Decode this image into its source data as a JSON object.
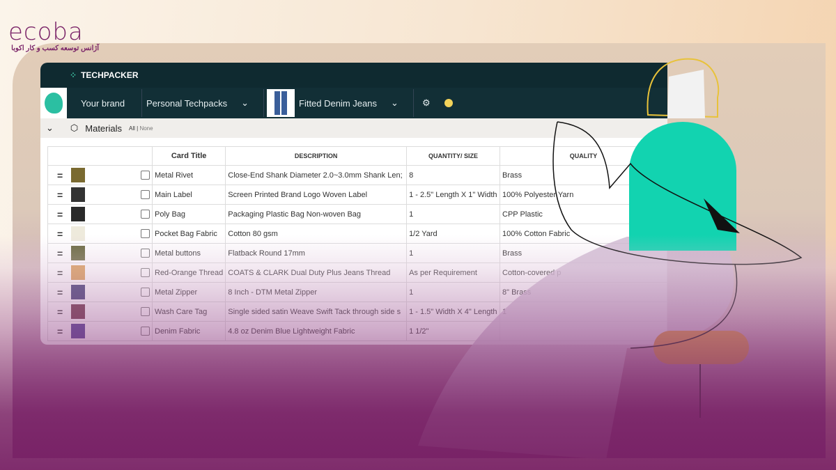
{
  "watermark": {
    "brand": "ecoba",
    "tagline": "آژانس توسعه کسب و کار اکوبا"
  },
  "app": {
    "name": "TECHPACKER"
  },
  "nav": {
    "brand": "Your brand",
    "workspace": "Personal Techpacks",
    "product": "Fitted Denim Jeans"
  },
  "section": {
    "title": "Materials",
    "all": "All",
    "sep": "|",
    "none": "None"
  },
  "table": {
    "headers": [
      "Card Title",
      "DESCRIPTION",
      "QUANTITY/ SIZE",
      "QUALITY"
    ],
    "rows": [
      {
        "title": "Metal Rivet",
        "description": "Close-End  Shank Diameter 2.0~3.0mm Shank Len;",
        "qty": "8",
        "quality": "Brass",
        "thumb": "#7a6a30"
      },
      {
        "title": "Main Label",
        "description": "Screen Printed Brand Logo Woven Label",
        "qty": "1 - 2.5\" Length X 1\" Width",
        "quality": "100% Polyester Yarn",
        "thumb": "#333"
      },
      {
        "title": "Poly Bag",
        "description": "Packaging Plastic Bag Non-woven Bag",
        "qty": "1",
        "quality": "CPP Plastic",
        "thumb": "#2a2a2a"
      },
      {
        "title": "Pocket Bag Fabric",
        "description": "Cotton 80 gsm",
        "qty": "1/2 Yard",
        "quality": "100% Cotton Fabric",
        "thumb": "#eeeadc"
      },
      {
        "title": "Metal buttons",
        "description": "Flatback Round 17mm",
        "qty": "1",
        "quality": "Brass",
        "thumb": "#6a6a40"
      },
      {
        "title": "Red-Orange Thread",
        "description": "COATS & CLARK Dual Duty Plus Jeans Thread",
        "qty": "As per Requirement",
        "quality": "Cotton-covered p",
        "thumb": "#d89a50"
      },
      {
        "title": "Metal Zipper",
        "description": " 8 Inch - DTM Metal Zipper",
        "qty": "1",
        "quality": "8\" Brass",
        "thumb": "#3a3870"
      },
      {
        "title": "Wash Care Tag",
        "description": "Single sided satin Weave Swift Tack through side s",
        "qty": "1 - 1.5\" Width X 4\" Length",
        "quality": "1",
        "thumb": "#6a3040"
      },
      {
        "title": "Denim Fabric",
        "description": "4.8 oz Denim Blue Lightweight Fabric",
        "qty": "1 1/2\"",
        "quality": "",
        "thumb": "#4a3a90"
      }
    ]
  },
  "colors": {
    "header": "#0f2a30",
    "accent": "#12d3b0",
    "brand": "#7a2468",
    "status_dot": "#f3d35a"
  }
}
